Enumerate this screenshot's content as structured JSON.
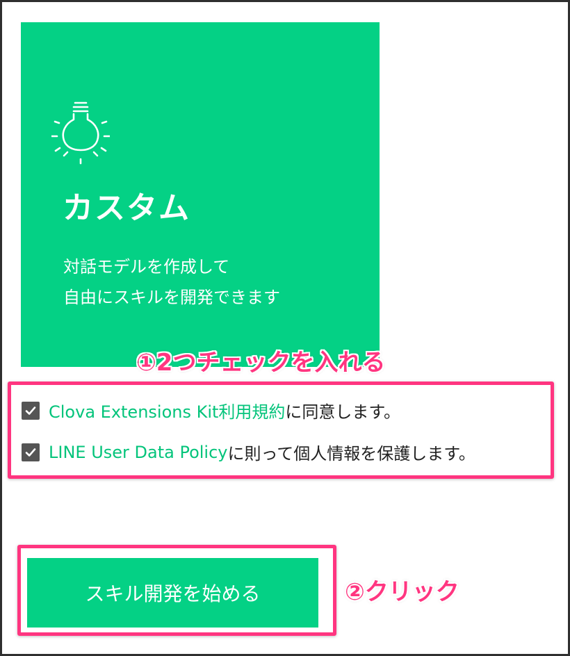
{
  "card": {
    "icon": "lightbulb-icon",
    "title": "カスタム",
    "description_line1": "対話モデルを作成して",
    "description_line2": "自由にスキルを開発できます"
  },
  "annotations": {
    "step1": "①2つチェックを入れる",
    "step2": "②クリック"
  },
  "agreements": [
    {
      "checked": true,
      "link_text": "Clova Extensions Kit利用規約",
      "suffix": "に同意します。"
    },
    {
      "checked": true,
      "link_text": "LINE User Data Policy",
      "suffix": "に則って個人情報を保護します。"
    }
  ],
  "start_button": {
    "label": "スキル開発を始める"
  },
  "colors": {
    "brand_green": "#04d185",
    "link_green": "#04c47b",
    "annotation_pink": "#ff3580",
    "checkbox_gray": "#555555"
  }
}
